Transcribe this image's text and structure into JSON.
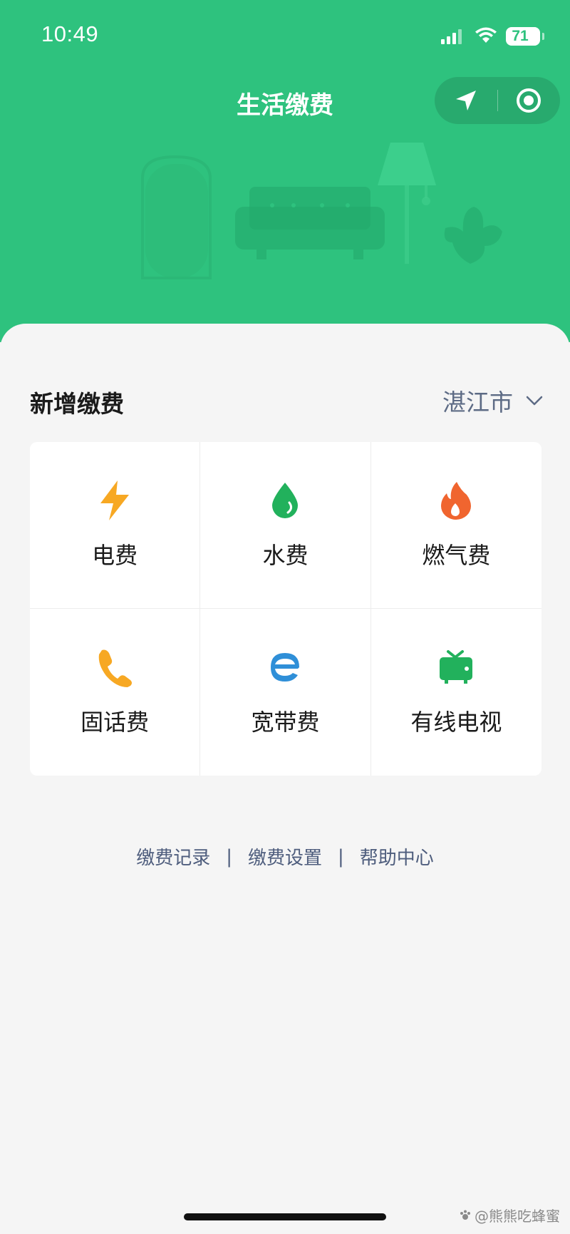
{
  "status_bar": {
    "time": "10:49",
    "battery": "71"
  },
  "nav": {
    "title": "生活缴费"
  },
  "section": {
    "title": "新增缴费",
    "city": "湛江市"
  },
  "services": [
    {
      "label": "电费",
      "icon": "lightning-icon",
      "color": "#f7a823"
    },
    {
      "label": "水费",
      "icon": "water-drop-icon",
      "color": "#22b15c"
    },
    {
      "label": "燃气费",
      "icon": "flame-icon",
      "color": "#f0652f"
    },
    {
      "label": "固话费",
      "icon": "phone-icon",
      "color": "#f7a823"
    },
    {
      "label": "宽带费",
      "icon": "broadband-icon",
      "color": "#2f8fd8"
    },
    {
      "label": "有线电视",
      "icon": "tv-icon",
      "color": "#22b15c"
    }
  ],
  "footer": {
    "links": [
      "缴费记录",
      "缴费设置",
      "帮助中心"
    ],
    "separator": "|"
  },
  "watermark": "@熊熊吃蜂蜜",
  "colors": {
    "header_green": "#2ec27e",
    "link_blue": "#4e5d7d"
  }
}
